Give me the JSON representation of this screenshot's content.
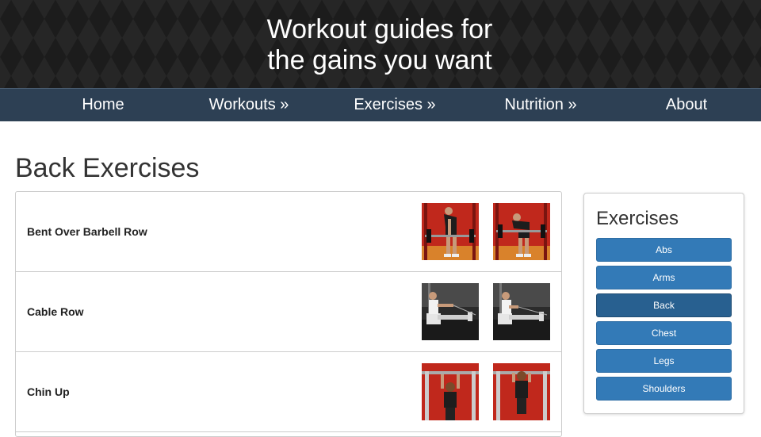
{
  "header": {
    "tagline_line1": "Workout guides for",
    "tagline_line2": "the gains you want"
  },
  "nav": {
    "home": "Home",
    "workouts": "Workouts »",
    "exercises": "Exercises »",
    "nutrition": "Nutrition »",
    "about": "About"
  },
  "page": {
    "title": "Back Exercises"
  },
  "exercises": [
    {
      "name": "Bent Over Barbell Row"
    },
    {
      "name": "Cable Row"
    },
    {
      "name": "Chin Up"
    }
  ],
  "sidebar": {
    "title": "Exercises",
    "categories": [
      "Abs",
      "Arms",
      "Back",
      "Chest",
      "Legs",
      "Shoulders"
    ],
    "active": "Back"
  },
  "colors": {
    "nav_bg": "#2d4054",
    "button": "#337ab7",
    "button_active": "#286090",
    "photo_red_bg": "#c0281c",
    "photo_gym_bg": "#2b2b2b"
  }
}
